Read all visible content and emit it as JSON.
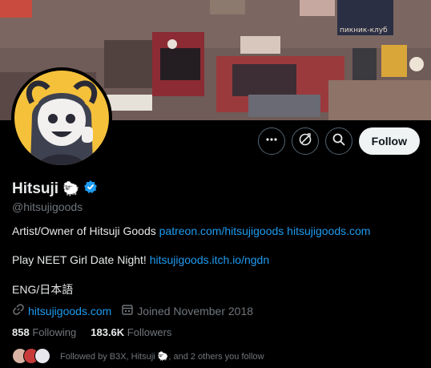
{
  "profile": {
    "display_name": "Hitsuji",
    "name_emoji": "🐑",
    "handle": "@hitsujigoods",
    "bio_line1_text": "Artist/Owner of Hitsuji Goods ",
    "bio_line1_link1": "patreon.com/hitsujigoods",
    "bio_line1_link2": "hitsujigoods.com",
    "bio_line2_text": "Play NEET Girl Date Night! ",
    "bio_line2_link": "hitsujigoods.itch.io/ngdn",
    "bio_line3_text": "ENG/日本語",
    "website": "hitsujigoods.com",
    "joined": "Joined November 2018",
    "following_count": "858",
    "following_label": "Following",
    "followers_count": "183.6K",
    "followers_label": "Followers",
    "followed_by": "Followed by B3X, Hitsuji 🐑, and 2 others you follow"
  },
  "actions": {
    "follow_label": "Follow"
  },
  "banner": {
    "sign_text": "пикник-клуб"
  },
  "colors": {
    "accent": "#1d9bf0",
    "background": "#000000",
    "verified": "#1d9bf0",
    "avatar_bg": "#f5c13b"
  },
  "icons": [
    "more-icon",
    "subscribe-icon",
    "search-icon",
    "link-icon",
    "calendar-icon",
    "verified-icon"
  ]
}
